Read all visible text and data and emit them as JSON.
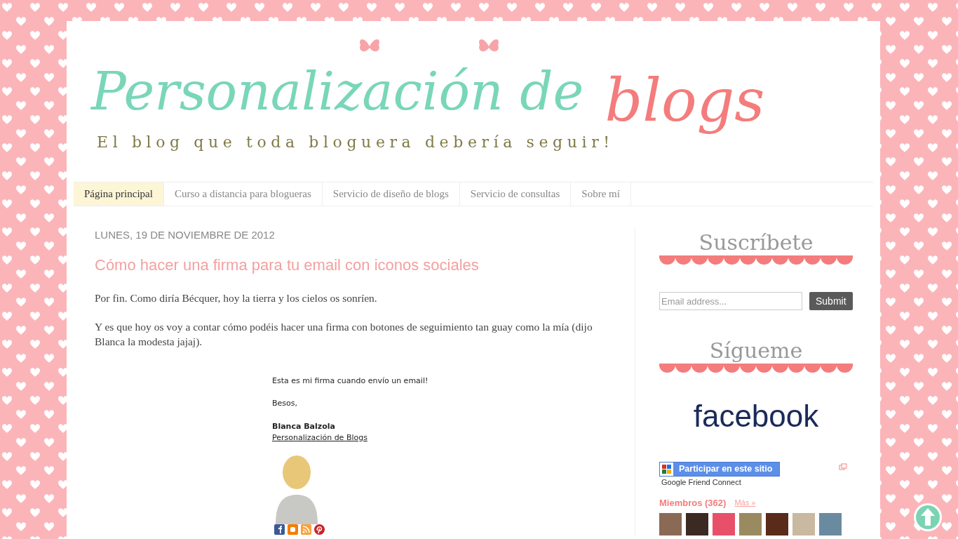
{
  "header": {
    "title_main": "Personalización de",
    "title_accent": "blogs",
    "tagline": "El blog que toda bloguera debería seguir!"
  },
  "nav": [
    {
      "label": "Página principal",
      "selected": true
    },
    {
      "label": "Curso a distancia para blogueras",
      "selected": false
    },
    {
      "label": "Servicio de diseño de blogs",
      "selected": false
    },
    {
      "label": "Servicio de consultas",
      "selected": false
    },
    {
      "label": "Sobre mí",
      "selected": false
    }
  ],
  "post": {
    "date": "LUNES, 19 DE NOVIEMBRE DE 2012",
    "title": "Cómo hacer una firma para tu email con iconos sociales",
    "paragraphs": [
      "Por fin. Como diría Bécquer, hoy la tierra y los cielos os sonríen.",
      "Y es que hoy os voy a contar cómo podéis hacer una firma con botones de seguimiento tan guay como la mía (dijo Blanca la modesta jajaj)."
    ],
    "signature": {
      "intro": "Esta es mi firma cuando envío un email!",
      "greeting": "Besos,",
      "name": "Blanca Balzola",
      "link": "Personalización de Blogs"
    }
  },
  "sidebar": {
    "subscribe_heading": "Suscríbete",
    "email_placeholder": "Email address...",
    "submit": "Submit",
    "follow_heading": "Sígueme",
    "facebook": "facebook",
    "gfc_button": "Participar en este sitio",
    "gfc_caption": "Google Friend Connect",
    "members": "Miembros (362)",
    "more": "Más »"
  }
}
